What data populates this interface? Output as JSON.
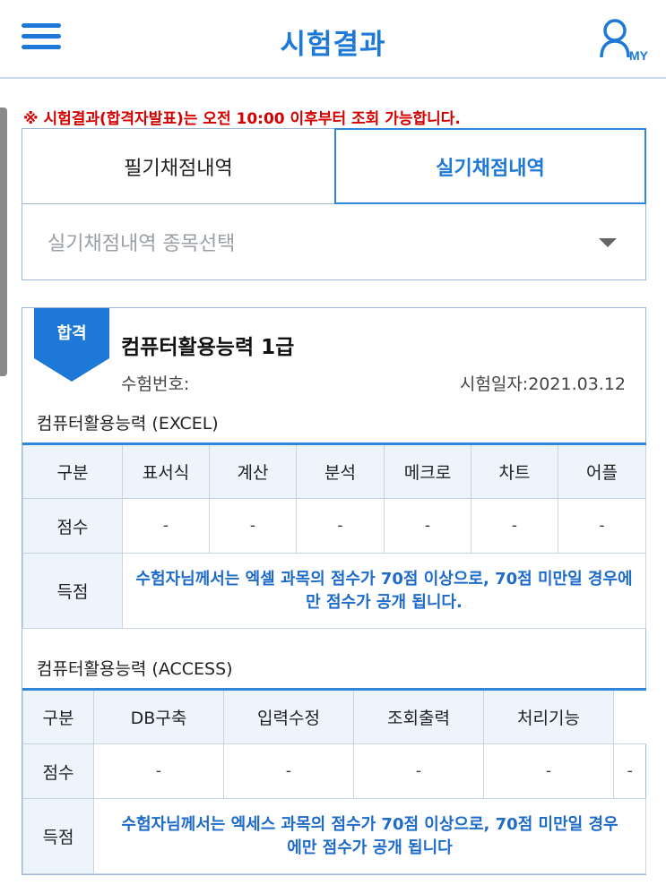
{
  "header": {
    "title": "시험결과",
    "my_label": "MY"
  },
  "notice": "※ 시험결과(합격자발표)는 오전 10:00 이후부터 조회 가능합니다.",
  "tabs": {
    "written": "필기채점내역",
    "practical": "실기채점내역"
  },
  "select": {
    "placeholder": "실기채점내역 종목선택"
  },
  "result": {
    "badge": "합격",
    "exam_name": "컴퓨터활용능력 1급",
    "exam_number_label": "수험번호:",
    "exam_date": "시험일자:2021.03.12"
  },
  "excel": {
    "title": "컴퓨터활용능력 (EXCEL)",
    "headers": [
      "구분",
      "표서식",
      "계산",
      "분석",
      "메크로",
      "차트",
      "어플"
    ],
    "score_label": "점수",
    "scores": [
      "-",
      "-",
      "-",
      "-",
      "-",
      "-"
    ],
    "obtained_label": "득점",
    "note": "수험자님께서는 엑셀 과목의 점수가 70점 이상으로, 70점 미만일 경우에만 점수가 공개 됩니다."
  },
  "access": {
    "title": "컴퓨터활용능력 (ACCESS)",
    "headers": [
      "구분",
      "DB구축",
      "입력수정",
      "조회출력",
      "처리기능"
    ],
    "score_label": "점수",
    "scores": [
      "-",
      "-",
      "-",
      "-",
      "-"
    ],
    "obtained_label": "득점",
    "note": "수험자님께서는 엑세스 과목의 점수가 70점 이상으로, 70점 미만일 경우에만 점수가 공개 됩니다"
  },
  "colors": {
    "accent": "#1e78d7",
    "notice_red": "#d40000",
    "note_blue": "#1e6bc9"
  }
}
